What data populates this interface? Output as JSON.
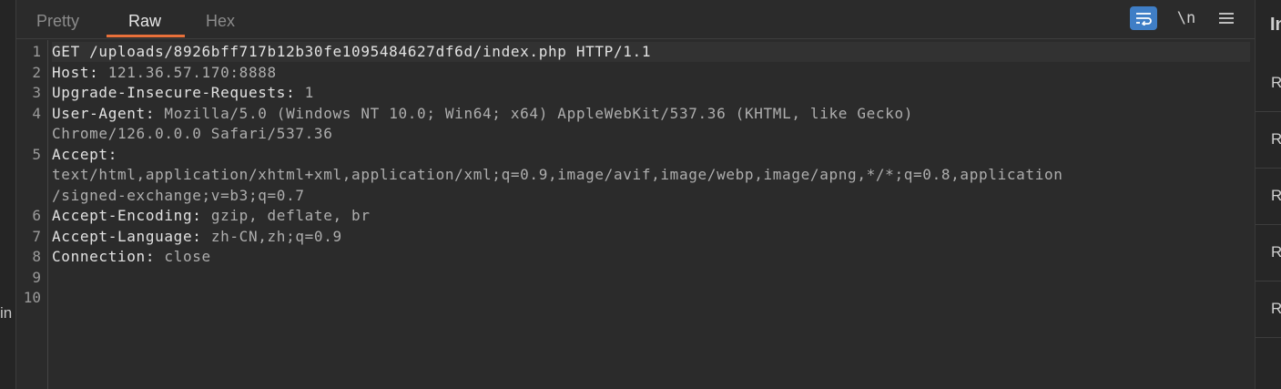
{
  "tabs": {
    "pretty": "Pretty",
    "raw": "Raw",
    "hex": "Hex",
    "active": "Raw"
  },
  "toolbar": {
    "wrap_icon": "wrap-lines-icon",
    "newline_label": "\\n",
    "menu_icon": "hamburger-menu-icon",
    "accent": "#3f7ec6"
  },
  "editor": {
    "line_numbers": [
      "1",
      "2",
      "3",
      "4",
      "5",
      "6",
      "7",
      "8",
      "9",
      "10"
    ],
    "request_line": "GET /uploads/8926bff717b12b30fe1095484627df6d/index.php HTTP/1.1",
    "host": {
      "key": "Host:",
      "value": " 121.36.57.170:8888"
    },
    "upgrade": {
      "key": "Upgrade-Insecure-Requests:",
      "value": " 1"
    },
    "user_agent": {
      "key": "User-Agent:",
      "value": " Mozilla/5.0 (Windows NT 10.0; Win64; x64) AppleWebKit/537.36 (KHTML, like Gecko)",
      "value_cont": "Chrome/126.0.0.0 Safari/537.36"
    },
    "accept": {
      "key": "Accept:",
      "value_line1": "text/html,application/xhtml+xml,application/xml;q=0.9,image/avif,image/webp,image/apng,*/*;q=0.8,application",
      "value_line2": "/signed-exchange;v=b3;q=0.7"
    },
    "accept_encoding": {
      "key": "Accept-Encoding:",
      "value": " gzip, deflate, br"
    },
    "accept_language": {
      "key": "Accept-Language:",
      "value": " zh-CN,zh;q=0.9"
    },
    "connection": {
      "key": "Connection:",
      "value": " close"
    }
  },
  "left_panel": {
    "clipped_text": "in"
  },
  "right_panel": {
    "header": "In",
    "rows": [
      "R",
      "R",
      "R",
      "R",
      "R"
    ]
  },
  "colors": {
    "accent_orange": "#e8703a",
    "background": "#2b2b2b"
  }
}
